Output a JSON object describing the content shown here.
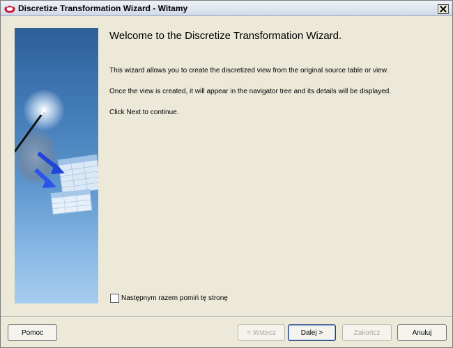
{
  "window": {
    "title": "Discretize Transformation Wizard - Witamy",
    "app_icon": "oracle-wizard-icon",
    "close_icon": "close-icon"
  },
  "side_art": {
    "icon": "magic-wand-tables-illustration"
  },
  "content": {
    "heading": "Welcome to the Discretize Transformation Wizard.",
    "paragraph1": "This wizard allows you to create the discretized view  from the original source table or view.",
    "paragraph2": "Once the view is created, it will appear in the navigator tree and its details will be displayed.",
    "paragraph3": "Click Next to continue."
  },
  "skip_checkbox": {
    "label": "Następnym razem pomiń tę stronę",
    "checked": false
  },
  "buttons": {
    "help": "Pomoc",
    "back": "< Wstecz",
    "next": "Dalej >",
    "finish": "Zakończ",
    "cancel": "Anuluj"
  },
  "colors": {
    "window_bg": "#ece9d8",
    "art_top": "#2e5f99",
    "art_bottom": "#a7cdef",
    "disabled_text": "#a9a9a0"
  }
}
